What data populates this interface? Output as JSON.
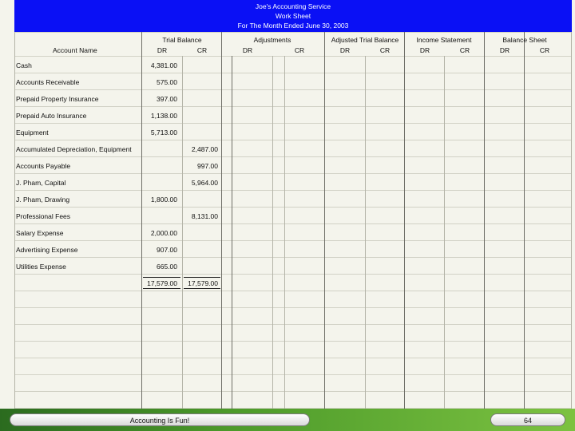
{
  "header": {
    "company": "Joe's Accounting Service",
    "doc_title": "Work Sheet",
    "period": "For The Month Ended June 30, 2003"
  },
  "columns": {
    "account_name": "Account Name",
    "groups": [
      {
        "label": "Trial Balance",
        "dr": "DR",
        "cr": "CR"
      },
      {
        "label": "Adjustments",
        "dr": "DR",
        "cr": "CR"
      },
      {
        "label": "Adjusted Trial Balance",
        "dr": "DR",
        "cr": "CR"
      },
      {
        "label": "Income Statement",
        "dr": "DR",
        "cr": "CR"
      },
      {
        "label": "Balance Sheet",
        "dr": "DR",
        "cr": "CR"
      }
    ]
  },
  "rows": [
    {
      "account": "Cash",
      "dr": "4,381.00",
      "cr": ""
    },
    {
      "account": "Accounts Receivable",
      "dr": "575.00",
      "cr": ""
    },
    {
      "account": "Prepaid Property Insurance",
      "dr": "397.00",
      "cr": ""
    },
    {
      "account": "Prepaid Auto Insurance",
      "dr": "1,138.00",
      "cr": ""
    },
    {
      "account": "Equipment",
      "dr": "5,713.00",
      "cr": ""
    },
    {
      "account": "Accumulated Depreciation, Equipment",
      "dr": "",
      "cr": "2,487.00"
    },
    {
      "account": "Accounts Payable",
      "dr": "",
      "cr": "997.00"
    },
    {
      "account": "J. Pham, Capital",
      "dr": "",
      "cr": "5,964.00"
    },
    {
      "account": "J. Pham, Drawing",
      "dr": "1,800.00",
      "cr": ""
    },
    {
      "account": "Professional Fees",
      "dr": "",
      "cr": "8,131.00"
    },
    {
      "account": "Salary Expense",
      "dr": "2,000.00",
      "cr": ""
    },
    {
      "account": "Advertising Expense",
      "dr": "907.00",
      "cr": ""
    },
    {
      "account": "Utilities Expense",
      "dr": "665.00",
      "cr": ""
    }
  ],
  "totals": {
    "dr": "17,579.00",
    "cr": "17,579.00"
  },
  "footer": {
    "caption": "Accounting Is Fun!",
    "page_number": "64"
  }
}
